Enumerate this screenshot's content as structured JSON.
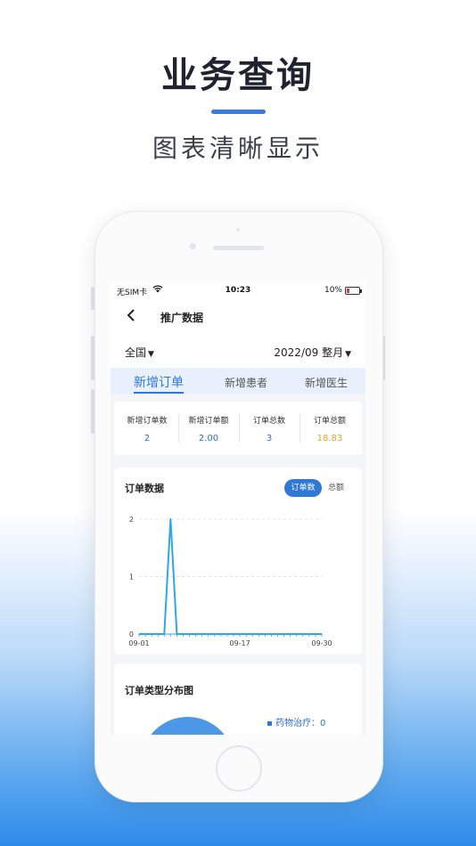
{
  "promo": {
    "headline": "业务查询",
    "subline": "图表清晰显示",
    "accent_color": "#3a7be0"
  },
  "status_bar": {
    "carrier": "无SIM卡",
    "wifi_icon": "wifi-icon",
    "time": "10:23",
    "battery": "10%"
  },
  "nav": {
    "back_icon": "chevron-left-icon",
    "title": "推广数据"
  },
  "filter": {
    "region": "全国",
    "period": "2022/09 整月"
  },
  "tabs": [
    {
      "label": "新增订单",
      "active": true
    },
    {
      "label": "新增患者",
      "active": false
    },
    {
      "label": "新增医生",
      "active": false
    }
  ],
  "stats": [
    {
      "label": "新增订单数",
      "value": "2"
    },
    {
      "label": "新增订单额",
      "value": "2.00"
    },
    {
      "label": "订单总数",
      "value": "3"
    },
    {
      "label": "订单总额",
      "value": "18.83"
    }
  ],
  "order_card": {
    "title": "订单数据",
    "toggle_on": "订单数",
    "toggle_off": "总额"
  },
  "chart_data": {
    "type": "line",
    "x_ticks": [
      "09-01",
      "09-17",
      "09-30"
    ],
    "y_ticks": [
      "0",
      "1",
      "2"
    ],
    "ylim": [
      0,
      2
    ],
    "grid": true,
    "series": [
      {
        "color": "#2ea7e8",
        "values": [
          0,
          0,
          0,
          0,
          0,
          2,
          0,
          0,
          0,
          0,
          0,
          0,
          0,
          0,
          0,
          0,
          0,
          0,
          0,
          0,
          0,
          0,
          0,
          0,
          0,
          0,
          0,
          0,
          0,
          0
        ]
      }
    ]
  },
  "type_card": {
    "title": "订单类型分布图",
    "legend_item": "药物治疗：0"
  }
}
